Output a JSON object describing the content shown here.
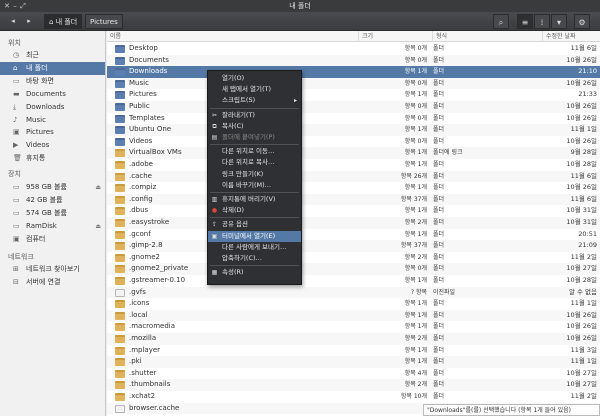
{
  "window": {
    "title": "내 폴더"
  },
  "toolbar": {
    "back_icon": "back-arrow-icon",
    "forward_icon": "forward-arrow-icon",
    "breadcrumbs": [
      {
        "label": "내 폴더",
        "icon": "home-icon",
        "active": true
      },
      {
        "label": "Pictures",
        "active": false
      }
    ]
  },
  "sidebar": {
    "places_heading": "위치",
    "places": [
      {
        "label": "최근",
        "icon": "clock-icon"
      },
      {
        "label": "내 폴더",
        "icon": "home-icon",
        "selected": true
      },
      {
        "label": "바탕 화면",
        "icon": "desktop-icon"
      },
      {
        "label": "Documents",
        "icon": "folder-icon"
      },
      {
        "label": "Downloads",
        "icon": "download-icon"
      },
      {
        "label": "Music",
        "icon": "music-icon"
      },
      {
        "label": "Pictures",
        "icon": "picture-icon"
      },
      {
        "label": "Videos",
        "icon": "video-icon"
      },
      {
        "label": "휴지통",
        "icon": "trash-icon"
      }
    ],
    "devices_heading": "장치",
    "devices": [
      {
        "label": "958 GB 볼륨",
        "icon": "drive-icon",
        "eject": true
      },
      {
        "label": "42 GB 볼륨",
        "icon": "drive-icon"
      },
      {
        "label": "574 GB 볼륨",
        "icon": "drive-icon"
      },
      {
        "label": "RamDisk",
        "icon": "drive-icon",
        "eject": true
      },
      {
        "label": "컴퓨터",
        "icon": "computer-icon"
      }
    ],
    "network_heading": "네트워크",
    "network": [
      {
        "label": "네트워크 찾아보기",
        "icon": "network-icon"
      },
      {
        "label": "서버에 연결",
        "icon": "server-icon"
      }
    ]
  },
  "columns": {
    "name": "이름",
    "size": "크기",
    "type": "형식",
    "modified": "수정한 날짜"
  },
  "files": [
    {
      "name": "Desktop",
      "size": "항목 0개",
      "type": "폴더",
      "modified": "11월 6일",
      "icon": "blue"
    },
    {
      "name": "Documents",
      "size": "항목 0개",
      "type": "폴더",
      "modified": "10월 26일",
      "icon": "blue"
    },
    {
      "name": "Downloads",
      "size": "항목 1개",
      "type": "폴더",
      "modified": "21:10",
      "icon": "blue",
      "selected": true
    },
    {
      "name": "Music",
      "size": "항목 0개",
      "type": "폴더",
      "modified": "10월 26일",
      "icon": "blue"
    },
    {
      "name": "Pictures",
      "size": "항목 1개",
      "type": "폴더",
      "modified": "21:33",
      "icon": "blue"
    },
    {
      "name": "Public",
      "size": "항목 0개",
      "type": "폴더",
      "modified": "10월 26일",
      "icon": "blue"
    },
    {
      "name": "Templates",
      "size": "항목 0개",
      "type": "폴더",
      "modified": "10월 26일",
      "icon": "blue"
    },
    {
      "name": "Ubuntu One",
      "size": "항목 1개",
      "type": "폴더",
      "modified": "11월 1일",
      "icon": "blue"
    },
    {
      "name": "Videos",
      "size": "항목 0개",
      "type": "폴더",
      "modified": "10월 26일",
      "icon": "blue"
    },
    {
      "name": "VirtualBox VMs",
      "size": "항목 1개",
      "type": "폴더에 링크",
      "modified": "9월 28일",
      "icon": "yellow"
    },
    {
      "name": ".adobe",
      "size": "항목 1개",
      "type": "폴더",
      "modified": "10월 28일",
      "icon": "yellow"
    },
    {
      "name": ".cache",
      "size": "항목 26개",
      "type": "폴더",
      "modified": "11월 6일",
      "icon": "yellow"
    },
    {
      "name": ".compiz",
      "size": "항목 1개",
      "type": "폴더",
      "modified": "10월 26일",
      "icon": "yellow"
    },
    {
      "name": ".config",
      "size": "항목 37개",
      "type": "폴더",
      "modified": "11월 6일",
      "icon": "yellow"
    },
    {
      "name": ".dbus",
      "size": "항목 1개",
      "type": "폴더",
      "modified": "10월 31일",
      "icon": "yellow"
    },
    {
      "name": ".easystroke",
      "size": "항목 2개",
      "type": "폴더",
      "modified": "10월 31일",
      "icon": "yellow"
    },
    {
      "name": ".gconf",
      "size": "항목 1개",
      "type": "폴더",
      "modified": "20:51",
      "icon": "yellow"
    },
    {
      "name": ".gimp-2.8",
      "size": "항목 37개",
      "type": "폴더",
      "modified": "21:09",
      "icon": "yellow"
    },
    {
      "name": ".gnome2",
      "size": "항목 2개",
      "type": "폴더",
      "modified": "11월 2일",
      "icon": "yellow"
    },
    {
      "name": ".gnome2_private",
      "size": "항목 0개",
      "type": "폴더",
      "modified": "10월 27일",
      "icon": "yellow"
    },
    {
      "name": ".gstreamer-0.10",
      "size": "항목 1개",
      "type": "폴더",
      "modified": "10월 28일",
      "icon": "yellow"
    },
    {
      "name": ".gvfs",
      "size": "? 항목",
      "type": "이진파일",
      "modified": "알 수 없음",
      "icon": "file"
    },
    {
      "name": ".icons",
      "size": "항목 1개",
      "type": "폴더",
      "modified": "11월 1일",
      "icon": "yellow"
    },
    {
      "name": ".local",
      "size": "항목 1개",
      "type": "폴더",
      "modified": "10월 26일",
      "icon": "yellow"
    },
    {
      "name": ".macromedia",
      "size": "항목 1개",
      "type": "폴더",
      "modified": "10월 26일",
      "icon": "yellow"
    },
    {
      "name": ".mozilla",
      "size": "항목 2개",
      "type": "폴더",
      "modified": "10월 26일",
      "icon": "yellow"
    },
    {
      "name": ".mplayer",
      "size": "항목 1개",
      "type": "폴더",
      "modified": "11월 3일",
      "icon": "yellow"
    },
    {
      "name": ".pki",
      "size": "항목 1개",
      "type": "폴더",
      "modified": "11월 1일",
      "icon": "yellow"
    },
    {
      "name": ".shutter",
      "size": "항목 4개",
      "type": "폴더",
      "modified": "10월 27일",
      "icon": "yellow"
    },
    {
      "name": ".thumbnails",
      "size": "항목 2개",
      "type": "폴더",
      "modified": "10월 27일",
      "icon": "yellow"
    },
    {
      "name": ".xchat2",
      "size": "항목 10개",
      "type": "폴더",
      "modified": "11월 2일",
      "icon": "yellow"
    },
    {
      "name": "browser.cache",
      "size": "",
      "type": "",
      "modified": "",
      "icon": "file"
    }
  ],
  "context_menu": [
    {
      "label": "열기(O)",
      "icon": ""
    },
    {
      "label": "새 탭에서 열기(T)",
      "icon": ""
    },
    {
      "label": "스크립트(S)",
      "icon": "",
      "submenu": true
    },
    {
      "sep": true
    },
    {
      "label": "잘라내기(T)",
      "icon": "cut-icon"
    },
    {
      "label": "복사(C)",
      "icon": "copy-icon"
    },
    {
      "label": "폴더에 붙여넣기(P)",
      "icon": "paste-icon",
      "disabled": true
    },
    {
      "sep": true
    },
    {
      "label": "다른 위치로 이동…",
      "icon": ""
    },
    {
      "label": "다른 위치로 복사…",
      "icon": ""
    },
    {
      "label": "링크 만들기(K)",
      "icon": ""
    },
    {
      "label": "이름 바꾸기(M)…",
      "icon": ""
    },
    {
      "sep": true
    },
    {
      "label": "휴지통에 버리기(V)",
      "icon": "trash-icon"
    },
    {
      "label": "삭제(D)",
      "icon": "delete-icon"
    },
    {
      "sep": true
    },
    {
      "label": "공유 옵션",
      "icon": "share-icon"
    },
    {
      "label": "터미널에서 열기(E)",
      "icon": "terminal-icon",
      "highlight": true
    },
    {
      "label": "다른 사람에게 보내기…",
      "icon": ""
    },
    {
      "label": "압축하기(C)…",
      "icon": ""
    },
    {
      "sep": true
    },
    {
      "label": "속성(R)",
      "icon": "properties-icon"
    }
  ],
  "status": "\"Downloads\"를(를) 선택했습니다 (항목 1개 들어 있음)"
}
